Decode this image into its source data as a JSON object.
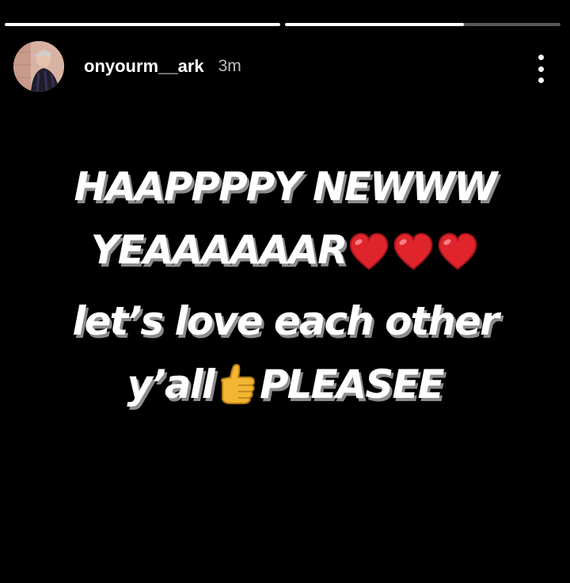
{
  "story": {
    "progress": [
      1.0,
      0.65
    ],
    "username": "onyourm__ark",
    "time_ago": "3m",
    "lines": [
      "HAAPPPPY NEWWW",
      "YEAAAAAAR",
      "let’s love each other",
      "y’all",
      "PLEASEE"
    ],
    "emojis": [
      "red-heart",
      "red-heart",
      "red-heart",
      "thumbs-up"
    ],
    "colors": {
      "background": "#000000",
      "text": "#ffffff",
      "text_shadow": "#8c8c8c",
      "heart": "#e0242c",
      "thumb": "#f2b632"
    }
  }
}
